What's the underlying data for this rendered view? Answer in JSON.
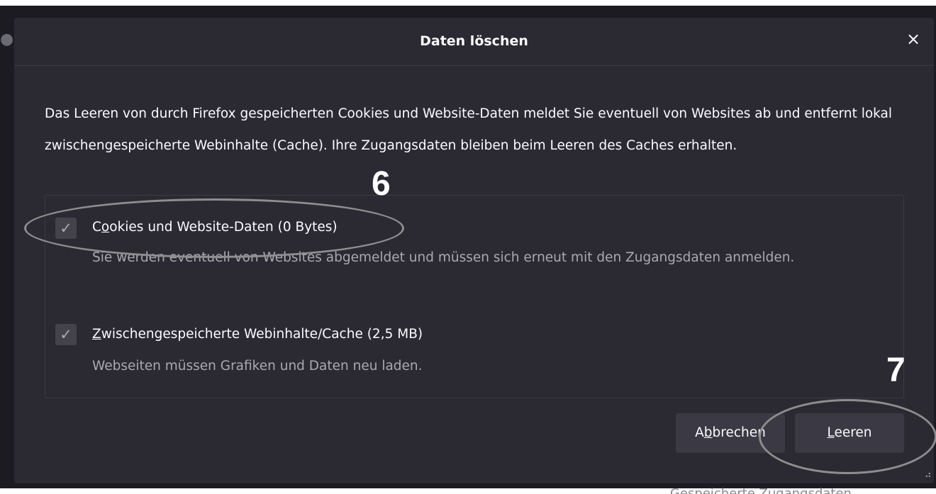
{
  "dialog": {
    "title": "Daten löschen",
    "close_symbol": "×",
    "description": "Das Leeren von durch Firefox gespeicherten Cookies und Website-Daten meldet Sie eventuell von Websites ab und entfernt lokal zwischengespeicherte Webinhalte (Cache). Ihre Zugangsdaten bleiben beim Leeren des Caches erhalten.",
    "options": [
      {
        "accesskey_pre": "C",
        "accesskey": "o",
        "accesskey_post": "okies und Website-Daten (0 Bytes)",
        "checked": true,
        "description": "Sie werden eventuell von Websites abgemeldet und müssen sich erneut mit den Zugangsdaten anmelden."
      },
      {
        "accesskey_pre": "",
        "accesskey": "Z",
        "accesskey_post": "wischengespeicherte Webinhalte/Cache (2,5 MB)",
        "checked": true,
        "description": "Webseiten müssen Grafiken und Daten neu laden."
      }
    ],
    "buttons": {
      "cancel": {
        "pre": "A",
        "key": "b",
        "post": "brechen"
      },
      "clear": {
        "pre": "",
        "key": "L",
        "post": "eeren"
      }
    }
  },
  "annotations": {
    "step6": "6",
    "step7": "7"
  },
  "background": {
    "status_text": "Gespeicherte Zugangsdaten"
  },
  "icons": {
    "checkmark": "✓",
    "close": "close-icon"
  },
  "colors": {
    "dialog_bg": "#2b2a33",
    "backdrop": "#1c1b22",
    "text": "#fbfbfe",
    "muted_text": "#a9a9b2",
    "button_bg": "#3a3944",
    "annotation_outline": "#8e8e8e"
  }
}
